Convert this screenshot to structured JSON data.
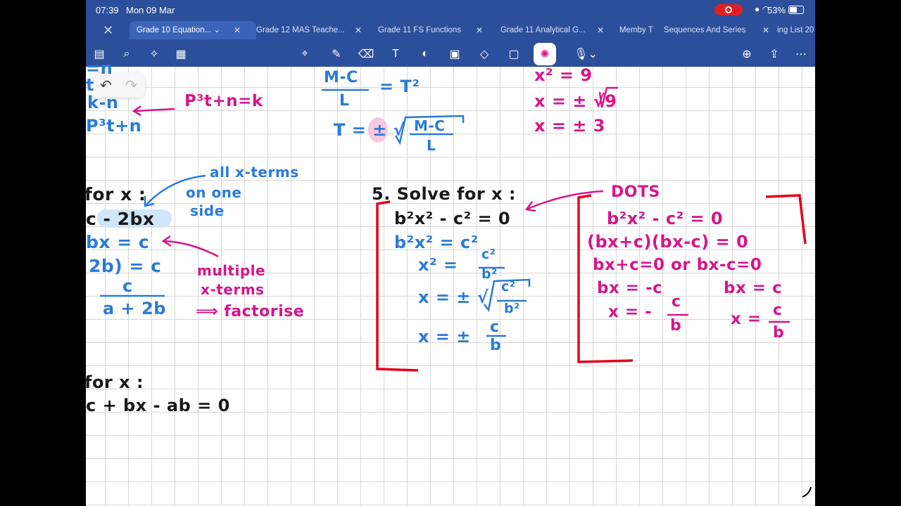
{
  "status": {
    "time": "07:39",
    "date": "Mon 09 Mar",
    "battery": "53%"
  },
  "tabs": [
    {
      "label": "Grade 10 Equation...",
      "active": true
    },
    {
      "label": "Grade 12 MAS Teache..."
    },
    {
      "label": "Grade 11 FS Functions"
    },
    {
      "label": "Grade 11 Analytical G..."
    },
    {
      "label": "Memby T"
    },
    {
      "label": "Sequences And Series"
    },
    {
      "label": "ing List 20"
    }
  ],
  "toolbar": {
    "icons": [
      "sidebar-icon",
      "search-icon",
      "sparkle-icon",
      "document-icon",
      "lasso-icon",
      "pen-icon",
      "eraser-icon",
      "text-icon",
      "shapes-icon",
      "image-icon",
      "elements-icon",
      "sticky-note-icon",
      "laser-pointer-icon",
      "microphone-icon",
      "add-page-icon",
      "share-icon",
      "more-icon"
    ]
  },
  "notes": {
    "top_left": {
      "l1": "=n",
      "l2": "t",
      "l3": "k-n",
      "l4": "P³t+n",
      "annot": "P³t+n=k"
    },
    "top_mid": {
      "l1": "M-C",
      "l1b": "L",
      "l1c": "= T²",
      "l2": "T = ± √",
      "l2n": "M-C",
      "l2d": "L"
    },
    "top_right": {
      "l1": "x² = 9",
      "l2": "x = ± √9",
      "l3": "x = ± 3"
    },
    "q4": {
      "title": "for x :",
      "l1": "c - 2bx",
      "l2": "bx = c",
      "l3": "2b) = c",
      "l4n": "c",
      "l4d": "a + 2b",
      "annot1": "all x-terms",
      "annot2": "on one",
      "annot3": "side",
      "annot4": "multiple",
      "annot5": "x-terms",
      "annot6": "⟹ factorise"
    },
    "q5": {
      "title": "5. Solve for x :",
      "l1": "b²x² - c² = 0",
      "l2": "b²x² = c²",
      "l3": "x² =",
      "l3n": "c²",
      "l3d": "b²",
      "l4": "x = ± √",
      "l4n": "c²",
      "l4d": "b²",
      "l5": "x = ±",
      "l5n": "c",
      "l5d": "b"
    },
    "dots": {
      "label": "DOTS",
      "l1": "b²x² - c² = 0",
      "l2": "(bx+c)(bx-c) = 0",
      "l3": "bx+c=0  or  bx-c=0",
      "l4a": "bx = -c",
      "l4b": "bx = c",
      "l5a": "x = -",
      "l5an": "c",
      "l5ad": "b",
      "l5b": "x =",
      "l5bn": "c",
      "l5bd": "b"
    },
    "q6": {
      "title": "for x :",
      "l1": "c + bx - ab = 0"
    }
  }
}
